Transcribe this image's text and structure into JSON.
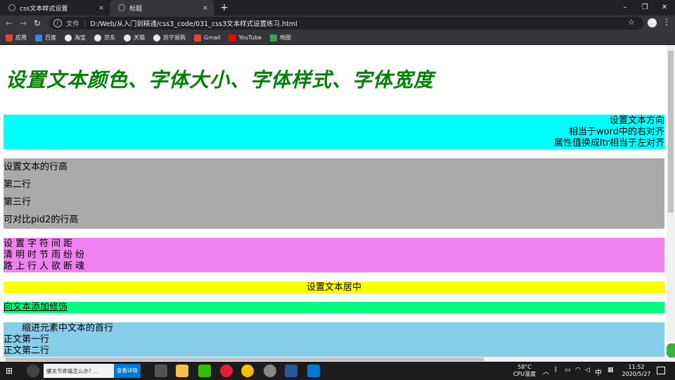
{
  "browser": {
    "tabs": [
      {
        "title": "css文本样式设置",
        "close": "×",
        "active": false
      },
      {
        "title": "标题",
        "close": "×",
        "active": true
      }
    ],
    "new_tab": "+",
    "window_controls": {
      "minimize": "–",
      "restore": "❐",
      "close": "✕"
    },
    "nav": {
      "back": "←",
      "forward": "→",
      "reload": "↻"
    },
    "address": {
      "scheme": "文件",
      "separator": "|",
      "url": "D:/Web/从入门到精通/css3_code/031_css3文本样式设置练习.html"
    },
    "star": "☆",
    "menu": "⋮",
    "bookmarks": [
      {
        "label": "应用",
        "icon": "apps-grid-icon",
        "color": "#ea4335"
      },
      {
        "label": "百度",
        "icon": "baidu-icon",
        "color": "#3b82f6"
      },
      {
        "label": "淘宝",
        "icon": "globe-icon",
        "color": "#e8eaed"
      },
      {
        "label": "京东",
        "icon": "globe-icon",
        "color": "#e8eaed"
      },
      {
        "label": "天猫",
        "icon": "globe-icon",
        "color": "#e8eaed"
      },
      {
        "label": "苏宁易购",
        "icon": "globe-icon",
        "color": "#e8eaed"
      },
      {
        "label": "Gmail",
        "icon": "gmail-icon",
        "color": "#ea4335"
      },
      {
        "label": "YouTube",
        "icon": "youtube-icon",
        "color": "#ff0000"
      },
      {
        "label": "地图",
        "icon": "maps-icon",
        "color": "#34a853"
      }
    ]
  },
  "page": {
    "heading": "设置文本颜色、字体大小、字体样式、字体宽度",
    "heading_color": "#008000",
    "direction_block": {
      "lines": [
        "设置文本方向",
        "相当于word中的右对齐",
        "属性值换成ltr相当于左对齐"
      ],
      "bg": "#00ffff"
    },
    "line_height_block": {
      "lines": [
        "设置文本的行高",
        "第二行",
        "第三行",
        "可对比pid2的行高"
      ],
      "bg": "#aaaaaa"
    },
    "spacing_block": {
      "lines": [
        "设置字符间距",
        "清明时节雨纷纷",
        "路上行人欲断魂"
      ],
      "bg": "#ee82ee"
    },
    "center_block": {
      "text": "设置文本居中",
      "bg": "#ffff00"
    },
    "decoration_block": {
      "text": "向文本添加修饰",
      "bg": "#00ff7f"
    },
    "indent_block": {
      "lines": [
        "缩进元素中文本的首行",
        "正文第一行",
        "正文第二行"
      ],
      "bg": "#87ceeb"
    }
  },
  "taskbar": {
    "search_text": "腰关节疼痛怎么办? ...",
    "search_button": "查看详情",
    "weather_temp": "58°C",
    "weather_label": "CPU温度",
    "ime": "中",
    "time": "11:52",
    "date": "2020/5/27"
  }
}
